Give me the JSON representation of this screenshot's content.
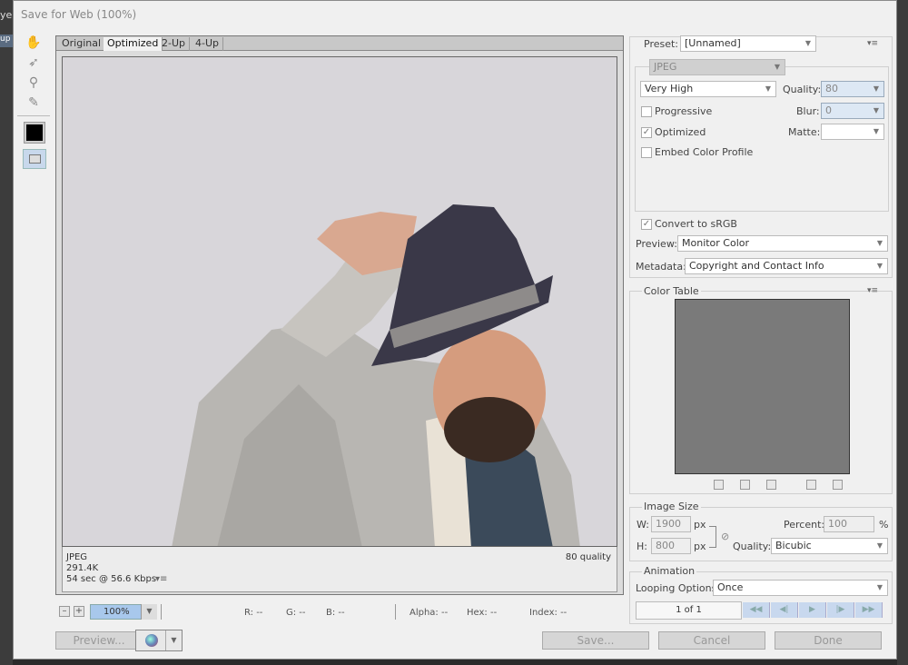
{
  "window": {
    "title": "Save for Web (100%)"
  },
  "background": {
    "left_text": "ye",
    "left_tab": "up"
  },
  "tools": [
    {
      "name": "hand-tool-icon",
      "glyph": "✋"
    },
    {
      "name": "slice-select-tool-icon",
      "glyph": "➶"
    },
    {
      "name": "zoom-tool-icon",
      "glyph": "⚲"
    },
    {
      "name": "eyedropper-tool-icon",
      "glyph": "✎"
    }
  ],
  "tabs": [
    "Original",
    "Optimized",
    "2-Up",
    "4-Up"
  ],
  "active_tab": "Optimized",
  "image_info": {
    "format": "JPEG",
    "size": "291.4K",
    "download_time": "54 sec @ 56.6 Kbps",
    "quality": "80 quality",
    "menu_glyph": "▾≡"
  },
  "status": {
    "zoom_minus": "–",
    "zoom_plus": "+",
    "zoom": "100%",
    "r": "R: --",
    "g": "G: --",
    "b": "B: --",
    "alpha": "Alpha: --",
    "hex": "Hex: --",
    "index": "Index: --"
  },
  "buttons": {
    "preview": "Preview...",
    "save": "Save...",
    "cancel": "Cancel",
    "done": "Done"
  },
  "settings": {
    "preset_label": "Preset:",
    "preset_value": "[Unnamed]",
    "format": "JPEG",
    "quality_preset": "Very High",
    "quality_label": "Quality:",
    "quality_value": "80",
    "progressive_label": "Progressive",
    "progressive_checked": false,
    "blur_label": "Blur:",
    "blur_value": "0",
    "optimized_label": "Optimized",
    "optimized_checked": true,
    "matte_label": "Matte:",
    "matte_value": "",
    "embed_label": "Embed Color Profile",
    "embed_checked": false,
    "srgb_label": "Convert to sRGB",
    "srgb_checked": true,
    "preview_label": "Preview:",
    "preview_value": "Monitor Color",
    "metadata_label": "Metadata:",
    "metadata_value": "Copyright and Contact Info"
  },
  "color_table": {
    "title": "Color Table",
    "swatch_color": "#7a7a7a"
  },
  "image_size": {
    "title": "Image Size",
    "w_label": "W:",
    "w_value": "1900",
    "h_label": "H:",
    "h_value": "800",
    "unit": "px",
    "percent_label": "Percent:",
    "percent_value": "100",
    "percent_unit": "%",
    "quality_label": "Quality:",
    "quality_value": "Bicubic"
  },
  "animation": {
    "title": "Animation",
    "looping_label": "Looping Options:",
    "looping_value": "Once",
    "frame_counter": "1 of 1",
    "controls": [
      "◀◀",
      "◀|",
      "▶",
      "|▶",
      "▶▶"
    ]
  },
  "colors": {
    "accent": "#a8c8ec",
    "dialog_bg": "#f0f0f0"
  }
}
